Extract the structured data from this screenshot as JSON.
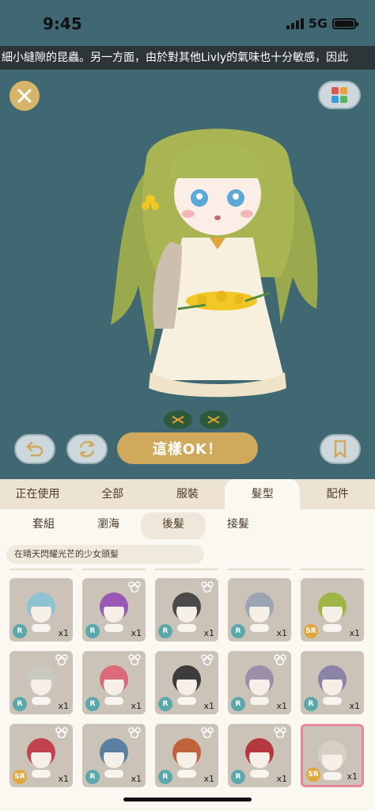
{
  "status": {
    "time": "9:45",
    "network": "5G"
  },
  "ticker": "細小縫隙的昆蟲。另一方面，由於對其他Livly的氣味也十分敏感，因此",
  "buttons": {
    "ok_label": "這樣OK！"
  },
  "main_tabs": [
    {
      "label": "正在使用",
      "active": false
    },
    {
      "label": "全部",
      "active": false
    },
    {
      "label": "服裝",
      "active": false
    },
    {
      "label": "髮型",
      "active": true
    },
    {
      "label": "配件",
      "active": false
    }
  ],
  "sub_tabs": [
    {
      "label": "套組",
      "active": false
    },
    {
      "label": "瀏海",
      "active": false
    },
    {
      "label": "後髮",
      "active": true
    },
    {
      "label": "接髮",
      "active": false
    }
  ],
  "subtitle": "在晴天閃耀光芒的少女頭髮",
  "items": [
    {
      "rarity": "R",
      "count": "x1",
      "hair": "#8fc3d2",
      "bear": false,
      "selected": false
    },
    {
      "rarity": "R",
      "count": "x1",
      "hair": "#9b59b6",
      "bear": true,
      "selected": false
    },
    {
      "rarity": "R",
      "count": "x1",
      "hair": "#4a4a4a",
      "bear": true,
      "selected": false
    },
    {
      "rarity": "R",
      "count": "x1",
      "hair": "#9aa5b1",
      "bear": false,
      "selected": false
    },
    {
      "rarity": "SR",
      "count": "x1",
      "hair": "#9fb545",
      "bear": false,
      "selected": false
    },
    {
      "rarity": "R",
      "count": "x1",
      "hair": "#c9c9c2",
      "bear": true,
      "selected": false
    },
    {
      "rarity": "R",
      "count": "x1",
      "hair": "#d96a7a",
      "bear": true,
      "selected": false
    },
    {
      "rarity": "R",
      "count": "x1",
      "hair": "#3c3c3c",
      "bear": true,
      "selected": false
    },
    {
      "rarity": "R",
      "count": "x1",
      "hair": "#9d8faa",
      "bear": true,
      "selected": false
    },
    {
      "rarity": "R",
      "count": "x1",
      "hair": "#8b83a8",
      "bear": false,
      "selected": false
    },
    {
      "rarity": "SR",
      "count": "x1",
      "hair": "#c0434d",
      "bear": true,
      "selected": false
    },
    {
      "rarity": "R",
      "count": "x1",
      "hair": "#5a7fa0",
      "bear": true,
      "selected": false
    },
    {
      "rarity": "R",
      "count": "x1",
      "hair": "#c0633a",
      "bear": true,
      "selected": false
    },
    {
      "rarity": "R",
      "count": "x1",
      "hair": "#b5383f",
      "bear": true,
      "selected": false
    },
    {
      "rarity": "SR",
      "count": "x1",
      "hair": "#d6cfc4",
      "bear": false,
      "selected": true
    }
  ],
  "colors": {
    "stage": "#3f6872",
    "gold": "#d1a95d",
    "tab_bg": "#ece3d4",
    "card_bg": "#cbc2b8"
  }
}
